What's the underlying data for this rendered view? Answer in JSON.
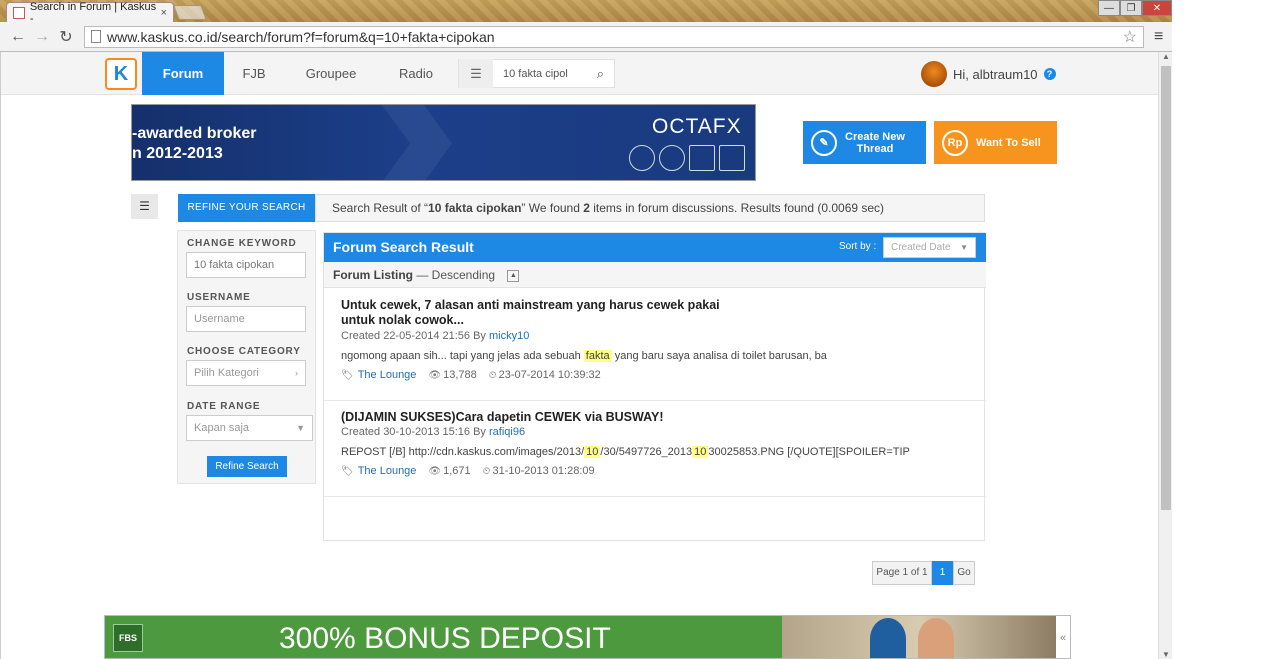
{
  "browser": {
    "tab_title": "Search in Forum | Kaskus -",
    "tab_close": "×",
    "url": "www.kaskus.co.id/search/forum?f=forum&q=10+fakta+cipokan",
    "back": "←",
    "forward": "→",
    "reload": "↻",
    "star": "☆",
    "menu": "≡",
    "win_min": "—",
    "win_max": "❐",
    "win_close": "✕"
  },
  "nav": {
    "logo": "K",
    "tabs": [
      "Forum",
      "FJB",
      "Groupee",
      "Radio"
    ],
    "search_value": "10 fakta cipol",
    "greeting": "Hi, albtraum10",
    "help": "?"
  },
  "banner": {
    "line1": "-awarded broker",
    "line2": "n 2012-2013",
    "brand": "OCTAFX"
  },
  "actions": {
    "create_line1": "Create New",
    "create_line2": "Thread",
    "create_icon": "✎",
    "sell": "Want To Sell",
    "sell_icon": "Rp"
  },
  "refine": {
    "header": "REFINE YOUR SEARCH",
    "change_keyword_label": "CHANGE KEYWORD",
    "keyword_value": "10 fakta cipokan",
    "username_label": "USERNAME",
    "username_placeholder": "Username",
    "category_label": "CHOOSE CATEGORY",
    "category_placeholder": "Pilih Kategori",
    "date_label": "DATE RANGE",
    "date_placeholder": "Kapan saja",
    "button": "Refine Search"
  },
  "result_summary": {
    "prefix": "Search Result of “",
    "query": "10 fakta cipokan",
    "mid": "” We found ",
    "count": "2",
    "suffix": " items in forum discussions. Results found (0.0069 sec)"
  },
  "panel": {
    "title": "Forum Search Result",
    "sort_label": "Sort by :",
    "sort_value": "Created Date",
    "listing_label": "Forum Listing",
    "listing_order": " — Descending"
  },
  "threads": [
    {
      "title_line1": "Untuk cewek, 7 alasan anti mainstream yang harus cewek pakai",
      "title_line2": "untuk nolak cowok...",
      "created": "Created 22-05-2014 21:56 By ",
      "author": "micky10",
      "snippet_a": "ngomong apaan sih... tapi yang jelas ada sebuah ",
      "snippet_hl1": "fakta",
      "snippet_b": " yang baru saya analisa di toilet barusan, ba",
      "category": "The Lounge",
      "views": "13,788",
      "last": "23-07-2014 10:39:32"
    },
    {
      "title_line1": "(DIJAMIN SUKSES)Cara dapetin CEWEK via BUSWAY!",
      "created": "Created 30-10-2013 15:16 By ",
      "author": "rafiqi96",
      "snippet_a": "REPOST [/B] http://cdn.kaskus.com/images/2013/",
      "snippet_hl1": "10",
      "snippet_b": "/30/5497726_2013",
      "snippet_hl2": "10",
      "snippet_c": "30025853.PNG [/QUOTE][SPOILER=TIP",
      "category": "The Lounge",
      "views": "1,671",
      "last": "31-10-2013 01:28:09"
    }
  ],
  "pager": {
    "info": "Page 1 of 1",
    "current": "1",
    "go": "Go"
  },
  "bottom_ad": {
    "logo": "FBS",
    "text": "300% BONUS DEPOSIT",
    "collapse": "«"
  },
  "colors": {
    "accent_blue": "#1e88e5",
    "accent_orange": "#f7941d",
    "highlight": "#ffff88"
  }
}
